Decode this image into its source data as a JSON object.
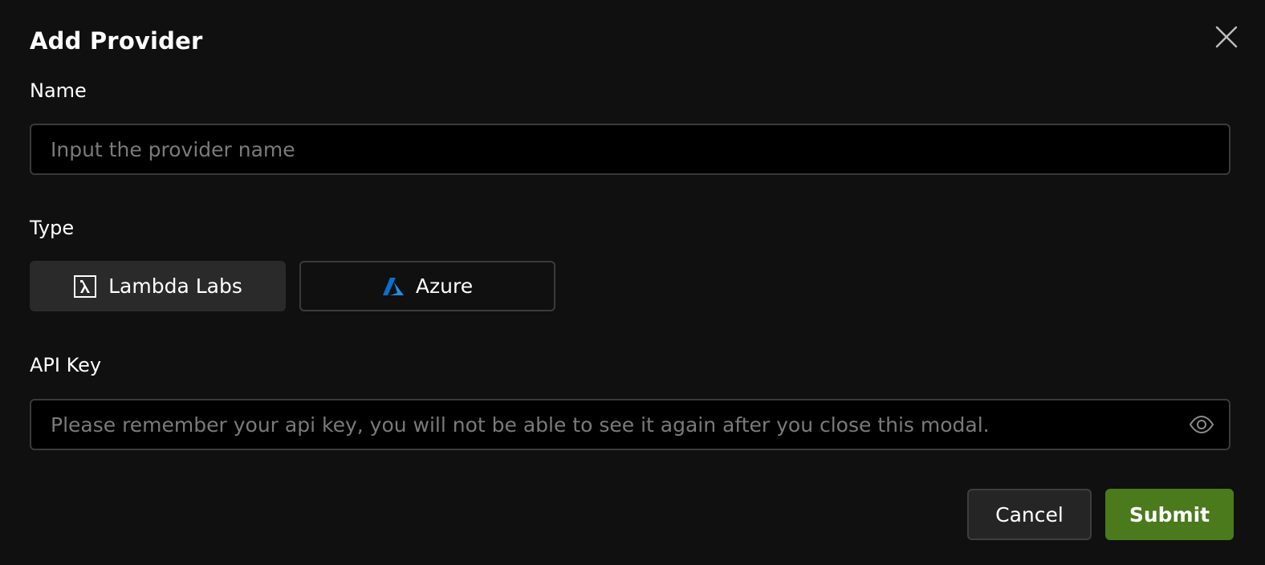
{
  "modal": {
    "title": "Add Provider",
    "close_icon": "close-icon"
  },
  "name_field": {
    "label": "Name",
    "value": "",
    "placeholder": "Input the provider name"
  },
  "type_field": {
    "label": "Type",
    "options": [
      {
        "label": "Lambda Labs",
        "icon": "lambda-icon",
        "selected": true
      },
      {
        "label": "Azure",
        "icon": "azure-icon",
        "selected": false
      }
    ]
  },
  "api_key_field": {
    "label": "API Key",
    "value": "",
    "placeholder": "Please remember your api key, you will not be able to see it again after you close this modal.",
    "toggle_icon": "eye-icon"
  },
  "actions": {
    "cancel_label": "Cancel",
    "submit_label": "Submit"
  },
  "colors": {
    "background": "#101010",
    "input_background": "#000000",
    "border": "#3a3a3a",
    "selected_option": "#2a2a2a",
    "submit": "#4a7a1c",
    "azure_blue": "#1f8fe0",
    "placeholder": "#7a7a7a"
  }
}
